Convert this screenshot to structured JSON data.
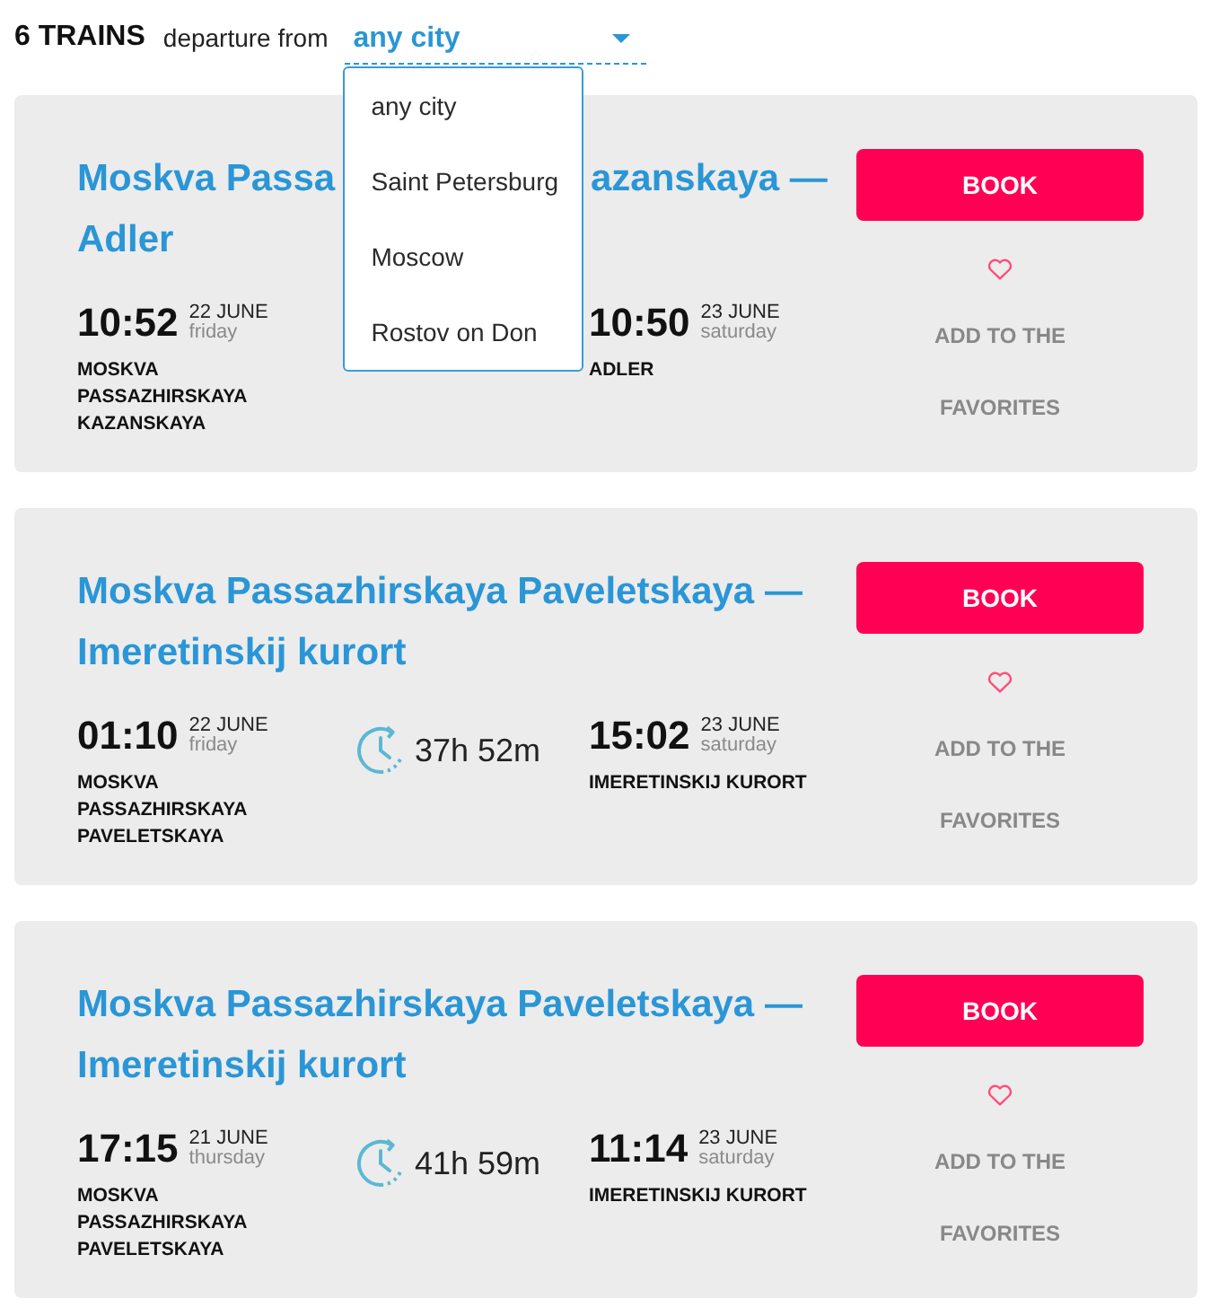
{
  "header": {
    "count": "6 TRAINS",
    "filter_label": "departure from",
    "filter": {
      "value": "any city",
      "expanded": true,
      "options": [
        "any city",
        "Saint Petersburg",
        "Moscow",
        "Rostov on Don"
      ]
    }
  },
  "cards": [
    {
      "title_parts": [
        "Moskva Passa",
        "azanskaya —",
        "Adler"
      ],
      "departure": {
        "time": "10:52",
        "date": "22 JUNE",
        "weekday": "friday",
        "station": "MOSKVA PASSAZHIRSKAYA KAZANSKAYA"
      },
      "arrival": {
        "time": "10:50",
        "date": "23 JUNE",
        "weekday": "saturday",
        "station": "ADLER"
      },
      "book_label": "BOOK",
      "favorite_label": "ADD TO THE FAVORITES",
      "favorited": false
    },
    {
      "title": "Moskva Passazhirskaya Paveletskaya — Imeretinskij kurort",
      "departure": {
        "time": "01:10",
        "date": "22 JUNE",
        "weekday": "friday",
        "station": "MOSKVA PASSAZHIRSKAYA PAVELETSKAYA"
      },
      "duration": "37h 52m",
      "arrival": {
        "time": "15:02",
        "date": "23 JUNE",
        "weekday": "saturday",
        "station": "IMERETINSKIJ KURORT"
      },
      "book_label": "BOOK",
      "favorite_label": "ADD TO THE FAVORITES",
      "favorited": false
    },
    {
      "title": "Moskva Passazhirskaya Paveletskaya — Imeretinskij kurort",
      "departure": {
        "time": "17:15",
        "date": "21 JUNE",
        "weekday": "thursday",
        "station": "MOSKVA PASSAZHIRSKAYA PAVELETSKAYA"
      },
      "duration": "41h 59m",
      "arrival": {
        "time": "11:14",
        "date": "23 JUNE",
        "weekday": "saturday",
        "station": "IMERETINSKIJ KURORT"
      },
      "book_label": "BOOK",
      "favorite_label": "ADD TO THE FAVORITES",
      "favorited": false
    }
  ]
}
